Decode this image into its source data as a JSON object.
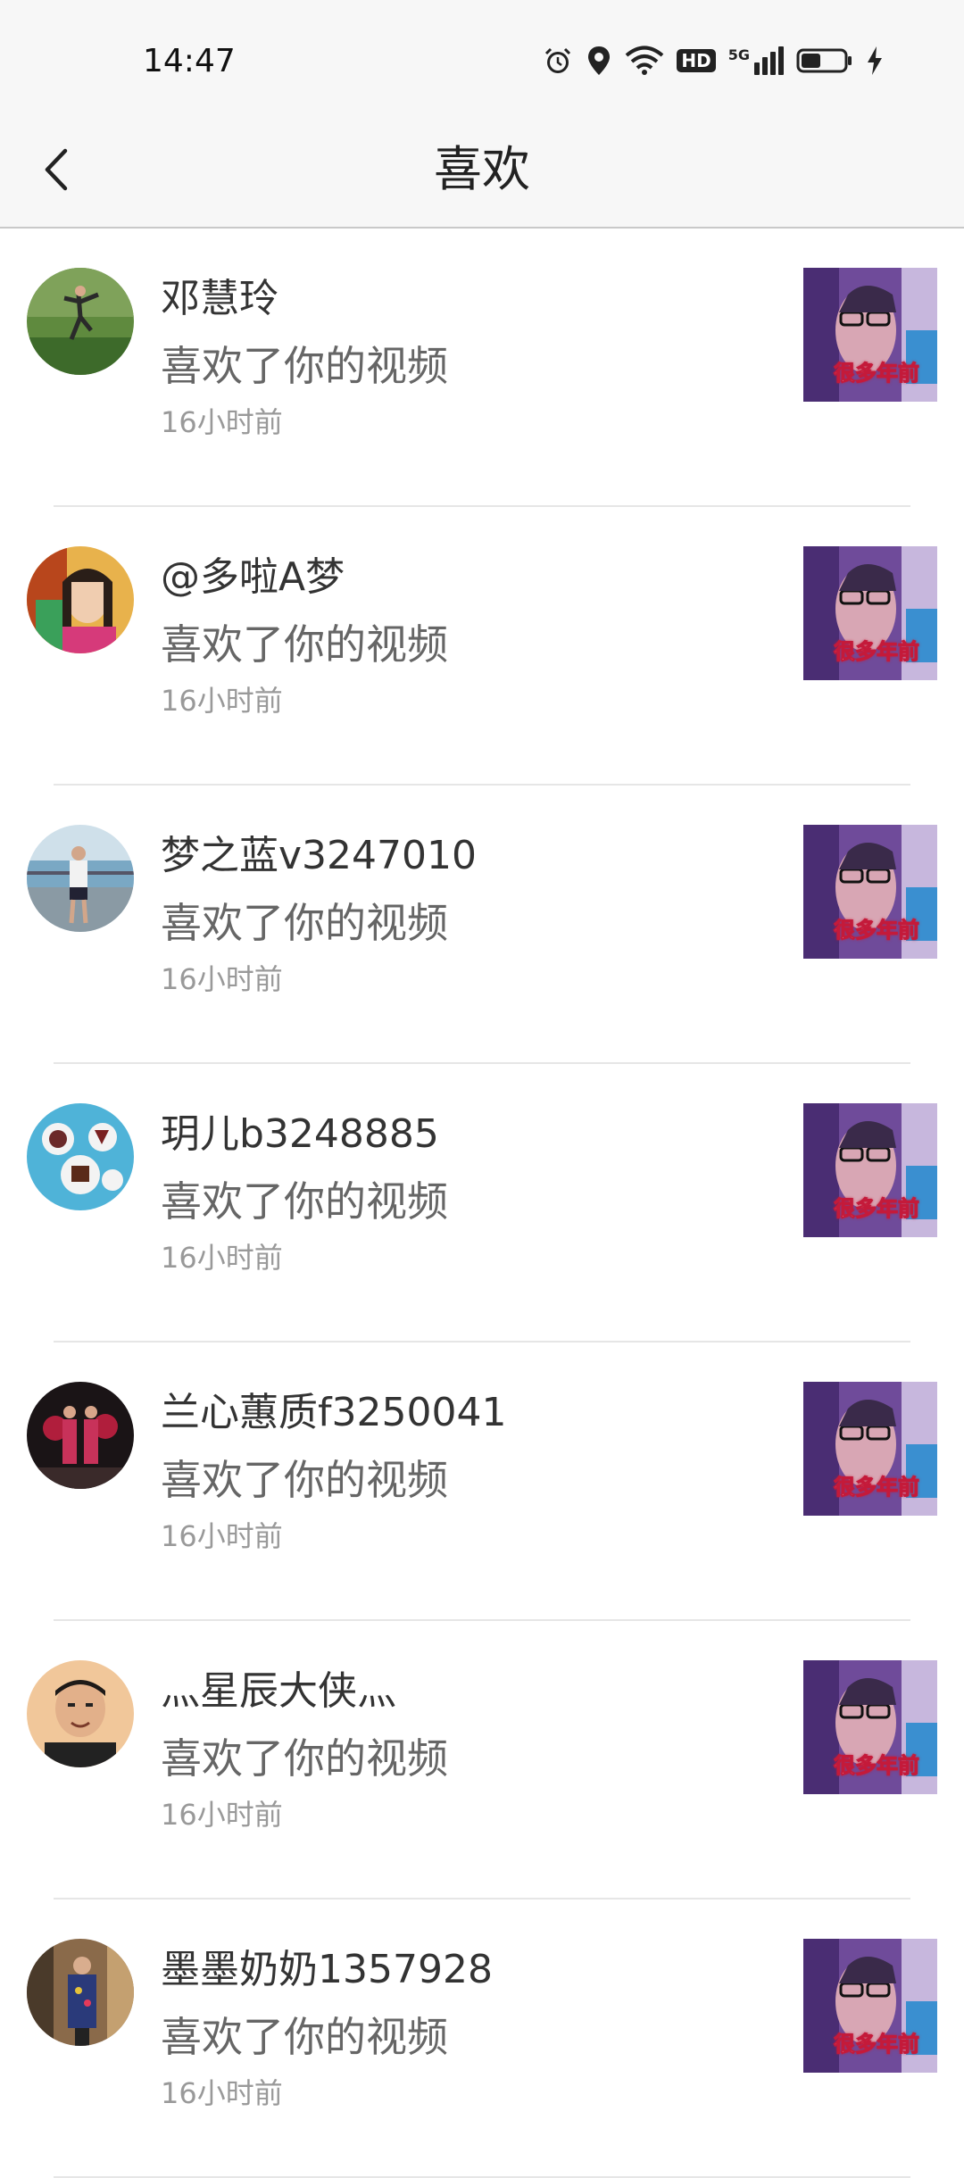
{
  "status_bar": {
    "time": "14:47",
    "icons": [
      "alarm-icon",
      "location-icon",
      "wifi-icon",
      "hd-icon",
      "signal-5g-icon",
      "battery-icon",
      "charging-icon"
    ],
    "hd_label": "HD",
    "network_label": "5G",
    "battery_level": 0.45
  },
  "nav": {
    "title": "喜欢",
    "back_icon": "chevron-left-icon"
  },
  "notifications": [
    {
      "name": "邓慧玲",
      "action": "喜欢了你的视频",
      "time": "16小时前",
      "thumb_caption": "很多年前"
    },
    {
      "name": "@多啦A梦",
      "action": "喜欢了你的视频",
      "time": "16小时前",
      "thumb_caption": "很多年前"
    },
    {
      "name": "梦之蓝v3247010",
      "action": "喜欢了你的视频",
      "time": "16小时前",
      "thumb_caption": "很多年前"
    },
    {
      "name": "玥儿b3248885",
      "action": "喜欢了你的视频",
      "time": "16小时前",
      "thumb_caption": "很多年前"
    },
    {
      "name": "兰心蕙质f3250041",
      "action": "喜欢了你的视频",
      "time": "16小时前",
      "thumb_caption": "很多年前"
    },
    {
      "name": "灬星辰大侠灬",
      "action": "喜欢了你的视频",
      "time": "16小时前",
      "thumb_caption": "很多年前"
    },
    {
      "name": "墨墨奶奶1357928",
      "action": "喜欢了你的视频",
      "time": "16小时前",
      "thumb_caption": "很多年前"
    }
  ],
  "colors": {
    "background": "#ffffff",
    "header": "#f7f7f7",
    "name_text": "#333333",
    "action_text": "#666666",
    "time_text": "#999999",
    "divider": "#e6e6e6"
  }
}
